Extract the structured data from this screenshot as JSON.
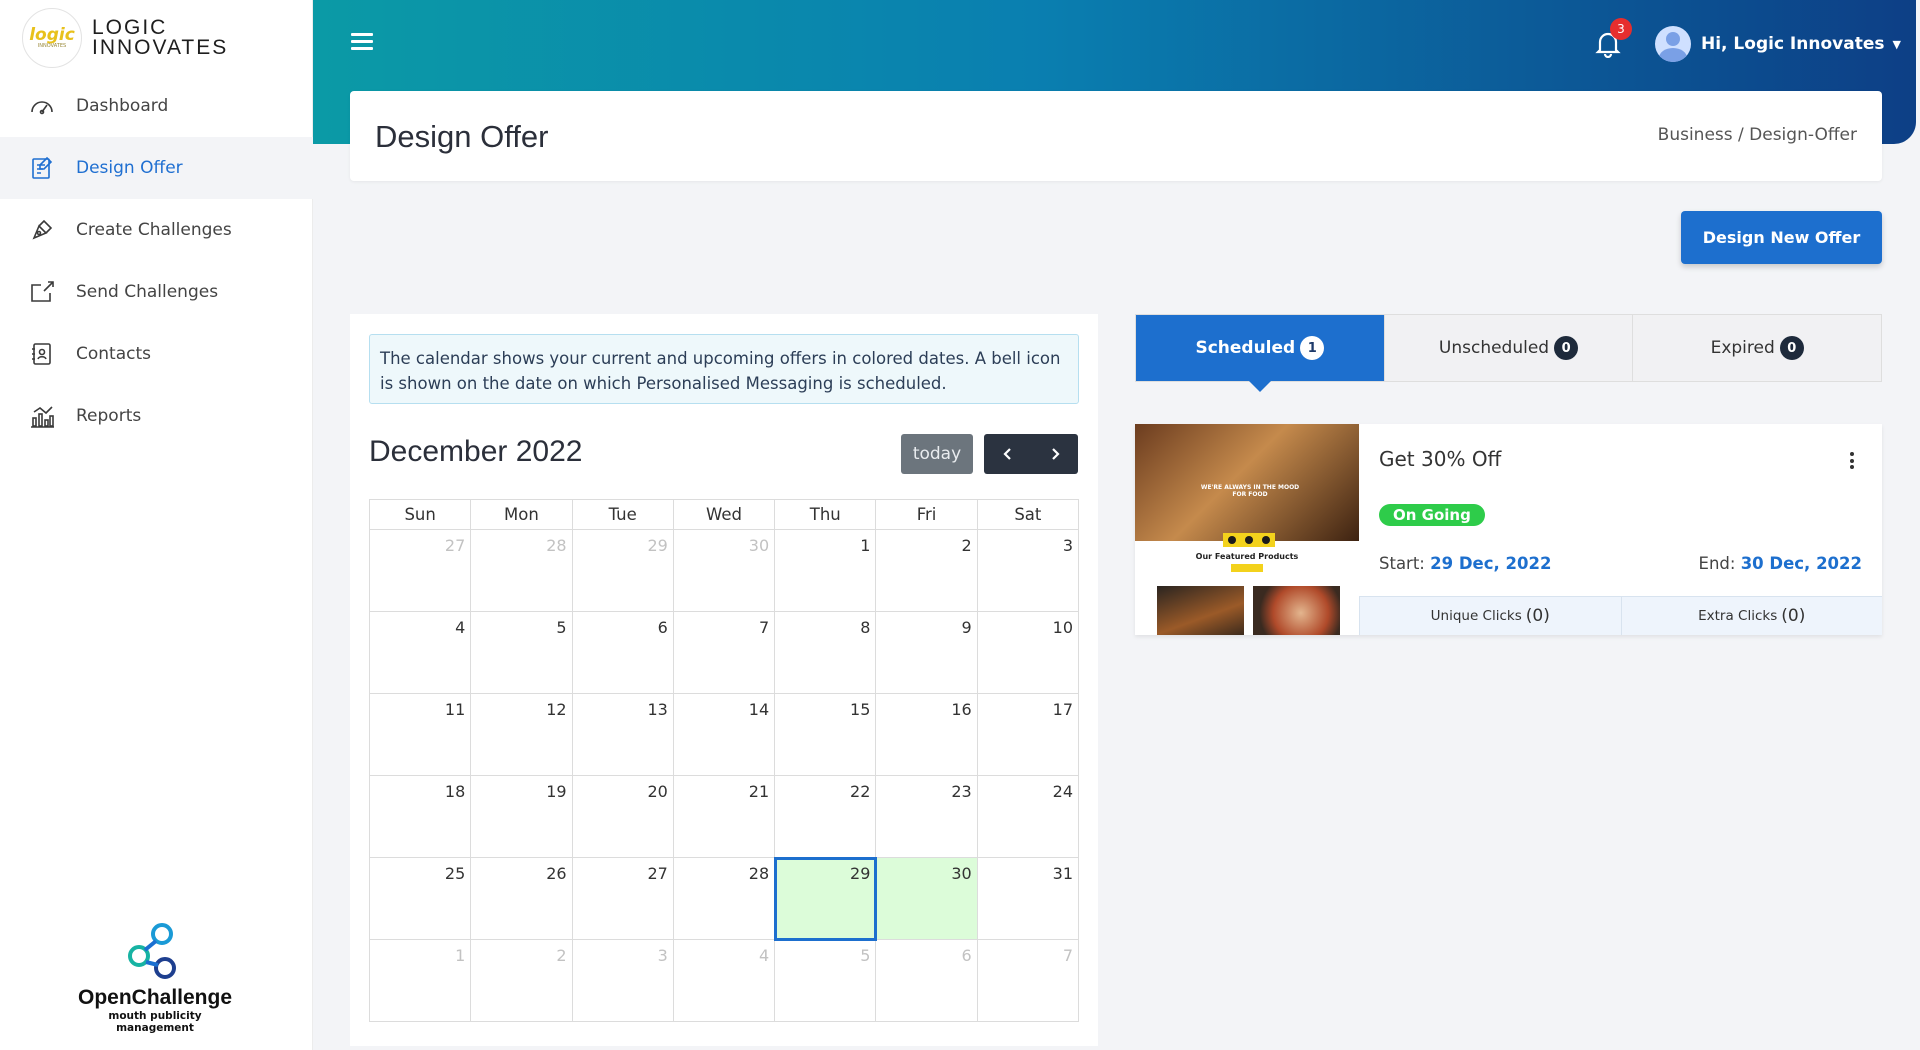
{
  "app": {
    "logo_mark": "logic",
    "logo_sub": "INNOVATES",
    "logo_line1": "LOGIC",
    "logo_line2": "INNOVATES"
  },
  "sidebar": {
    "items": [
      {
        "label": "Dashboard",
        "icon": "speedometer-icon"
      },
      {
        "label": "Design Offer",
        "icon": "edit-document-icon",
        "active": true
      },
      {
        "label": "Create Challenges",
        "icon": "pen-tool-icon"
      },
      {
        "label": "Send Challenges",
        "icon": "share-icon"
      },
      {
        "label": "Contacts",
        "icon": "contact-book-icon"
      },
      {
        "label": "Reports",
        "icon": "bar-chart-icon"
      }
    ],
    "brand_name": "OpenChallenge",
    "brand_tagline": "mouth publicity management"
  },
  "topbar": {
    "notification_count": "3",
    "user_greeting": "Hi, Logic Innovates"
  },
  "page": {
    "title": "Design Offer",
    "breadcrumb": "Business / Design-Offer",
    "new_offer_button": "Design New Offer"
  },
  "calendar": {
    "info": "The calendar shows your current and upcoming offers in colored dates. A bell icon is shown on the date on which Personalised Messaging is scheduled.",
    "month_label": "December 2022",
    "today_label": "today",
    "weekdays": [
      "Sun",
      "Mon",
      "Tue",
      "Wed",
      "Thu",
      "Fri",
      "Sat"
    ],
    "weeks": [
      [
        "27",
        "28",
        "29",
        "30",
        "1",
        "2",
        "3"
      ],
      [
        "4",
        "5",
        "6",
        "7",
        "8",
        "9",
        "10"
      ],
      [
        "11",
        "12",
        "13",
        "14",
        "15",
        "16",
        "17"
      ],
      [
        "18",
        "19",
        "20",
        "21",
        "22",
        "23",
        "24"
      ],
      [
        "25",
        "26",
        "27",
        "28",
        "29",
        "30",
        "31"
      ],
      [
        "1",
        "2",
        "3",
        "4",
        "5",
        "6",
        "7"
      ]
    ],
    "event_days": [
      "29",
      "30"
    ],
    "today_day": "29"
  },
  "tabs": [
    {
      "label": "Scheduled",
      "count": "1",
      "active": true
    },
    {
      "label": "Unscheduled",
      "count": "0"
    },
    {
      "label": "Expired",
      "count": "0"
    }
  ],
  "offer": {
    "title": "Get 30% Off",
    "status": "On Going",
    "start_label": "Start:",
    "start_date": "29 Dec, 2022",
    "end_label": "End:",
    "end_date": "30 Dec, 2022",
    "unique_clicks_label": "Unique Clicks",
    "unique_clicks": "(0)",
    "extra_clicks_label": "Extra Clicks",
    "extra_clicks": "(0)",
    "thumb_hero_text": "WE'RE ALWAYS IN THE MOOD FOR FOOD",
    "thumb_section_title": "Our Featured Products"
  },
  "colors": {
    "accent": "#1d6fce",
    "event": "#dcfcd9",
    "status": "#2ecc4a"
  }
}
